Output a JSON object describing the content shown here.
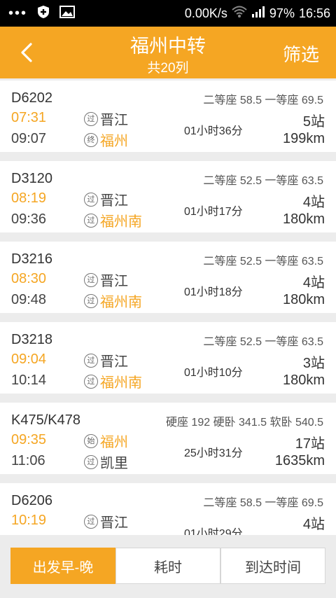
{
  "status_bar": {
    "speed": "0.00K/s",
    "battery": "97%",
    "time": "16:56"
  },
  "header": {
    "title": "福州中转",
    "subtitle": "共20列",
    "filter": "筛选"
  },
  "trains": [
    {
      "code": "D6202",
      "price": "二等座 58.5 一等座 69.5",
      "depart": "07:31",
      "arrive": "09:07",
      "from_badge": "过",
      "from_station": "晋江",
      "to_badge": "终",
      "to_station": "福州",
      "duration": "01小时36分",
      "stops": "5站",
      "distance": "199km"
    },
    {
      "code": "D3120",
      "price": "二等座 52.5 一等座 63.5",
      "depart": "08:19",
      "arrive": "09:36",
      "from_badge": "过",
      "from_station": "晋江",
      "to_badge": "过",
      "to_station": "福州南",
      "duration": "01小时17分",
      "stops": "4站",
      "distance": "180km"
    },
    {
      "code": "D3216",
      "price": "二等座 52.5 一等座 63.5",
      "depart": "08:30",
      "arrive": "09:48",
      "from_badge": "过",
      "from_station": "晋江",
      "to_badge": "过",
      "to_station": "福州南",
      "duration": "01小时18分",
      "stops": "4站",
      "distance": "180km"
    },
    {
      "code": "D3218",
      "price": "二等座 52.5 一等座 63.5",
      "depart": "09:04",
      "arrive": "10:14",
      "from_badge": "过",
      "from_station": "晋江",
      "to_badge": "过",
      "to_station": "福州南",
      "duration": "01小时10分",
      "stops": "3站",
      "distance": "180km"
    },
    {
      "code": "K475/K478",
      "price": "硬座 192 硬卧 341.5 软卧 540.5",
      "depart": "09:35",
      "arrive": "11:06",
      "from_badge": "始",
      "from_station": "福州",
      "to_badge": "过",
      "to_station": "凯里",
      "duration": "25小时31分",
      "stops": "17站",
      "distance": "1635km"
    },
    {
      "code": "D6206",
      "price": "二等座 58.5 一等座 69.5",
      "depart": "10:19",
      "arrive": "",
      "from_badge": "过",
      "from_station": "晋江",
      "to_badge": "",
      "to_station": "",
      "duration": "01小时29分",
      "stops": "4站",
      "distance": ""
    }
  ],
  "tabs": [
    "出发早-晚",
    "耗时",
    "到达时间"
  ],
  "colors": {
    "accent": "#f5a623",
    "background": "#ececec"
  }
}
